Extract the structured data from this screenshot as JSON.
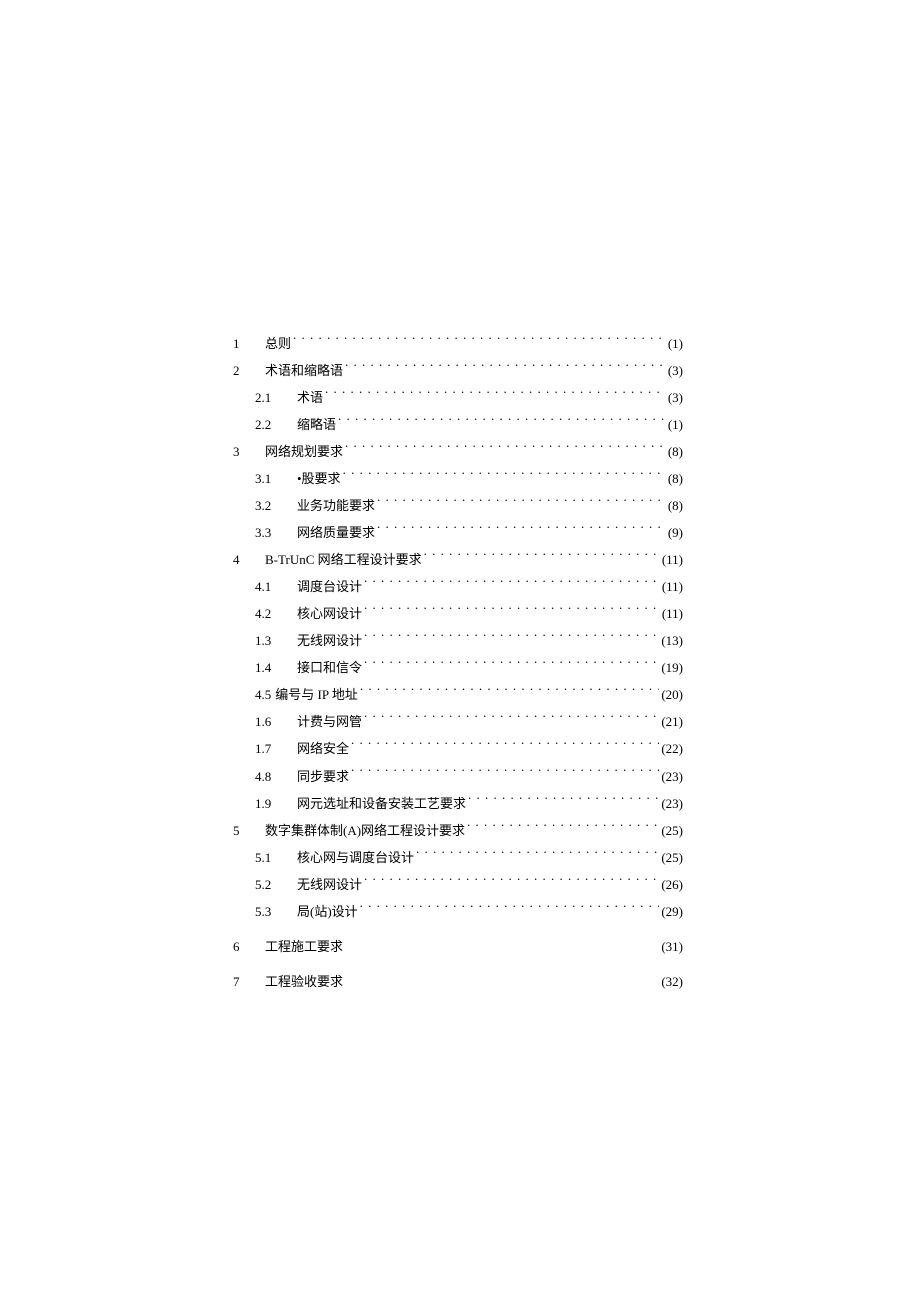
{
  "toc": [
    {
      "num": "1",
      "title": "总则",
      "page": "(1)",
      "level": 1,
      "dots": true
    },
    {
      "num": "2",
      "title": "术语和缩略语",
      "page": "(3)",
      "level": 1,
      "dots": true
    },
    {
      "num": "2.1",
      "title": "术语",
      "page": "(3)",
      "level": 2,
      "dots": true
    },
    {
      "num": "2.2",
      "title": "缩略语",
      "page": "(1)",
      "level": 2,
      "dots": true
    },
    {
      "num": "3",
      "title": "网络规划要求",
      "page": "(8)",
      "level": 1,
      "dots": true
    },
    {
      "num": "3.1",
      "title": "•股要求",
      "page": "(8)",
      "level": 2,
      "dots": true
    },
    {
      "num": "3.2",
      "title": "业务功能要求",
      "page": "(8)",
      "level": 2,
      "dots": true
    },
    {
      "num": "3.3",
      "title": "网络质量要求",
      "page": "(9)",
      "level": 2,
      "dots": true
    },
    {
      "num": "4",
      "title": "B-TrUnC 网络工程设计要求",
      "page": "(11)",
      "level": 1,
      "dots": true
    },
    {
      "num": "4.1",
      "title": "调度台设计",
      "page": "(11)",
      "level": 2,
      "dots": true
    },
    {
      "num": "4.2",
      "title": "核心网设计",
      "page": "(11)",
      "level": 2,
      "dots": true
    },
    {
      "num": "1.3",
      "title": "无线网设计",
      "page": "(13)",
      "level": 2,
      "dots": true
    },
    {
      "num": "1.4",
      "title": "接口和信令",
      "page": "(19)",
      "level": 2,
      "dots": true
    },
    {
      "num": "4.5",
      "title": "编号与 IP 地址",
      "page": "(20)",
      "level": 2,
      "dots": true,
      "tight": true
    },
    {
      "num": "1.6",
      "title": "计费与网管",
      "page": "(21)",
      "level": 2,
      "dots": true
    },
    {
      "num": "1.7",
      "title": "网络安全",
      "page": "(22)",
      "level": 2,
      "dots": true
    },
    {
      "num": "4.8",
      "title": "同步要求",
      "page": "(23)",
      "level": 2,
      "dots": true
    },
    {
      "num": "1.9",
      "title": "网元选址和设备安装工艺要求",
      "page": "(23)",
      "level": 2,
      "dots": true
    },
    {
      "num": "5",
      "title": "数字集群体制(A)网络工程设计要求",
      "page": "(25)",
      "level": 1,
      "dots": true
    },
    {
      "num": "5.1",
      "title": "核心网与调度台设计",
      "page": "(25)",
      "level": 2,
      "dots": true
    },
    {
      "num": "5.2",
      "title": "无线网设计",
      "page": "(26)",
      "level": 2,
      "dots": true
    },
    {
      "num": "5.3",
      "title": "局(站)设计",
      "page": "(29)",
      "level": 2,
      "dots": true
    },
    {
      "num": "6",
      "title": "工程施工要求",
      "page": "(31)",
      "level": 1,
      "dots": false
    },
    {
      "num": "7",
      "title": "工程验收要求",
      "page": "(32)",
      "level": 1,
      "dots": false
    }
  ]
}
